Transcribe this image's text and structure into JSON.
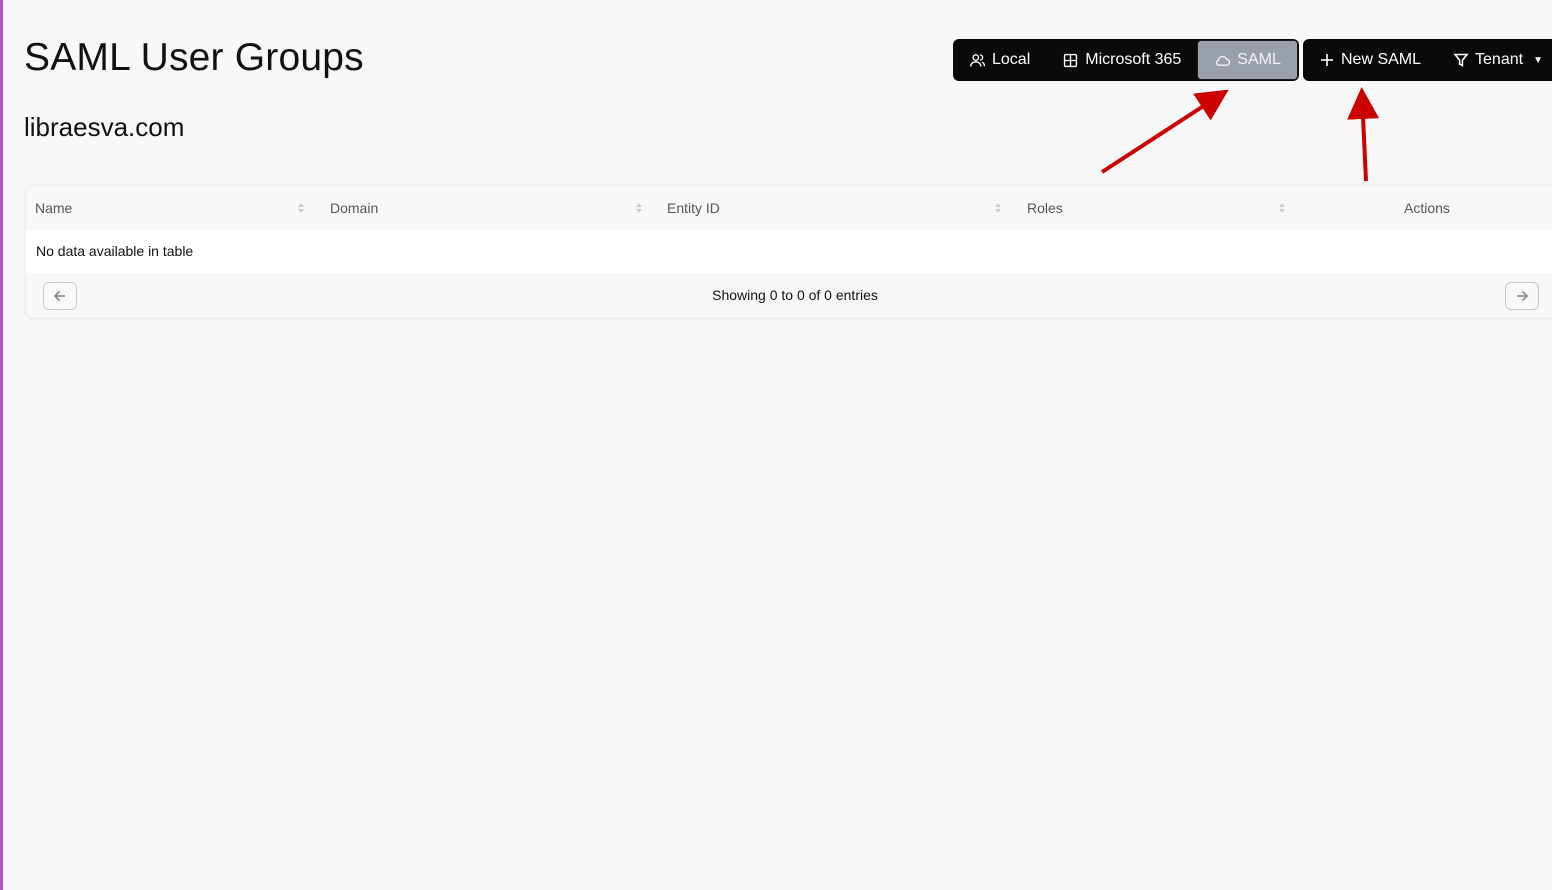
{
  "page": {
    "title": "SAML User Groups",
    "domain": "libraesva.com"
  },
  "source_toggle": {
    "items": [
      {
        "label": "Local",
        "icon": "users-icon",
        "active": false
      },
      {
        "label": "Microsoft 365",
        "icon": "windows-icon",
        "active": false
      },
      {
        "label": "SAML",
        "icon": "cloud-icon",
        "active": true
      }
    ]
  },
  "actions": {
    "new_label": "New SAML",
    "new_icon": "plus-icon",
    "filter_label": "Tenant",
    "filter_icon": "filter-icon"
  },
  "table": {
    "columns": [
      "Name",
      "Domain",
      "Entity ID",
      "Roles",
      "Actions"
    ],
    "empty_message": "No data available in table",
    "info": "Showing 0 to 0 of 0 entries"
  },
  "colors": {
    "background": "#f8f8f8",
    "toolbar": "#0a0a0a",
    "active_segment": "#9aa0aa",
    "annotation_arrow": "#cc0000",
    "left_accent": "#b552c4"
  }
}
